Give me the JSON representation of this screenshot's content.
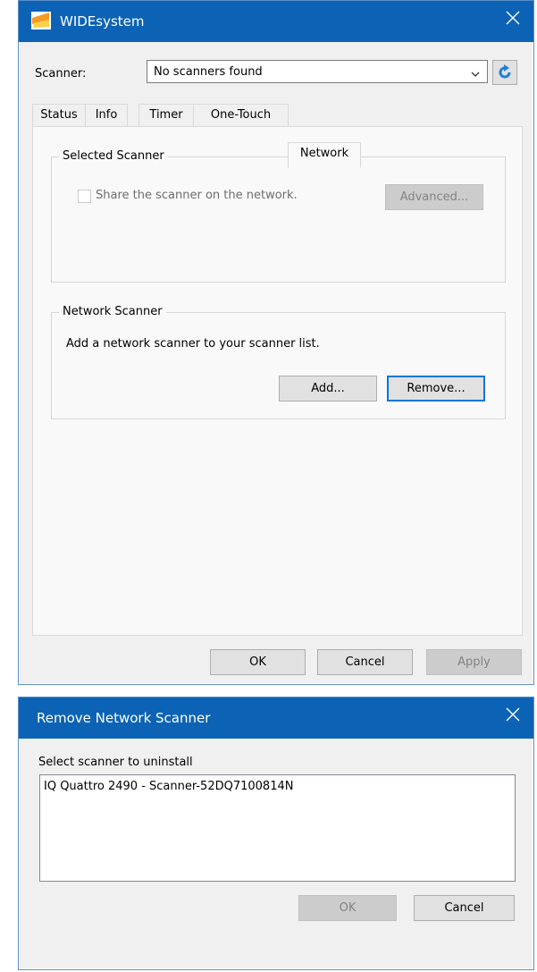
{
  "main_window": {
    "title": "WIDEsystem",
    "scanner_label": "Scanner:",
    "scanner_value": "No scanners found",
    "tabs": [
      {
        "label": "Status"
      },
      {
        "label": "Info"
      },
      {
        "label": "Timer"
      },
      {
        "label": "One-Touch"
      },
      {
        "label": "Network"
      }
    ],
    "active_tab": "Network",
    "selected_scanner_group": {
      "title": "Selected Scanner",
      "share_checkbox_label": "Share the scanner on the network.",
      "share_checked": false,
      "advanced_button": "Advanced..."
    },
    "network_scanner_group": {
      "title": "Network Scanner",
      "description": "Add a network scanner to your scanner list.",
      "add_button": "Add...",
      "remove_button": "Remove..."
    },
    "ok_button": "OK",
    "cancel_button": "Cancel",
    "apply_button": "Apply"
  },
  "remove_dialog": {
    "title": "Remove Network Scanner",
    "prompt": "Select scanner to uninstall",
    "scanners": [
      "IQ Quattro 2490 - Scanner-52DQ7100814N"
    ],
    "ok_button": "OK",
    "cancel_button": "Cancel"
  },
  "colors": {
    "titlebar": "#0c63b5",
    "accent": "#0078d7",
    "refresh_icon": "#1f7fd6",
    "logo_orange": "#f59a23",
    "logo_yellow": "#fbd24a"
  },
  "icons": [
    "logo-icon",
    "close-icon",
    "dropdown-arrow-icon",
    "refresh-icon"
  ]
}
